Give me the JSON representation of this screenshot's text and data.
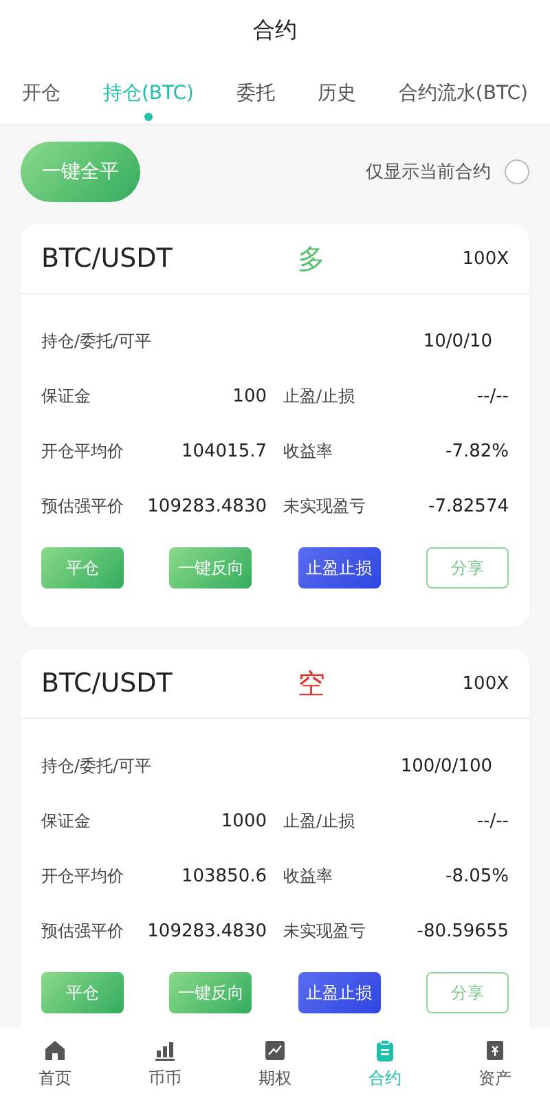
{
  "header": {
    "title": "合约"
  },
  "tabs": [
    {
      "label": "开仓",
      "selected": false
    },
    {
      "label": "持仓(BTC)",
      "selected": true
    },
    {
      "label": "委托",
      "selected": false
    },
    {
      "label": "历史",
      "selected": false
    },
    {
      "label": "合约流水(BTC)",
      "selected": false
    }
  ],
  "toolbar": {
    "close_all_button": "一键全平",
    "filter": {
      "label": "仅显示当前合约",
      "checked": false
    }
  },
  "positions": [
    {
      "pair": "BTC/USDT",
      "side": "多",
      "color": "#5cc26f",
      "leverage": "100X",
      "holding_label": "持仓/委托/可平",
      "holding_value": "10/0/10",
      "fields": [
        {
          "label": "保证金",
          "value": "100"
        },
        {
          "label": "止盈/止损",
          "value": "--/--"
        },
        {
          "label": "开仓平均价",
          "value": "104015.7"
        },
        {
          "label": "收益率",
          "value": "-7.82%"
        },
        {
          "label": "预估强平价",
          "value": "109283.4830"
        },
        {
          "label": "未实现盈亏",
          "value": "-7.82574"
        }
      ],
      "buttons": [
        {
          "label": "平仓",
          "kind": "green"
        },
        {
          "label": "一键反向",
          "kind": "green"
        },
        {
          "label": "止盈止损",
          "kind": "blue"
        },
        {
          "label": "分享",
          "kind": "outline"
        }
      ]
    },
    {
      "pair": "BTC/USDT",
      "side": "空",
      "color": "#e0312b",
      "leverage": "100X",
      "holding_label": "持仓/委托/可平",
      "holding_value": "100/0/100",
      "fields": [
        {
          "label": "保证金",
          "value": "1000"
        },
        {
          "label": "止盈/止损",
          "value": "--/--"
        },
        {
          "label": "开仓平均价",
          "value": "103850.6"
        },
        {
          "label": "收益率",
          "value": "-8.05%"
        },
        {
          "label": "预估强平价",
          "value": "109283.4830"
        },
        {
          "label": "未实现盈亏",
          "value": "-80.59655"
        }
      ],
      "buttons": [
        {
          "label": "平仓",
          "kind": "green"
        },
        {
          "label": "一键反向",
          "kind": "green"
        },
        {
          "label": "止盈止损",
          "kind": "blue"
        },
        {
          "label": "分享",
          "kind": "outline"
        }
      ]
    }
  ],
  "bottom_nav": [
    {
      "label": "首页",
      "kind": "home",
      "selected": false
    },
    {
      "label": "币币",
      "kind": "bars",
      "selected": false
    },
    {
      "label": "期权",
      "kind": "chart",
      "selected": false
    },
    {
      "label": "合约",
      "kind": "clipboard",
      "selected": true
    },
    {
      "label": "资产",
      "kind": "wallet",
      "selected": false
    }
  ]
}
